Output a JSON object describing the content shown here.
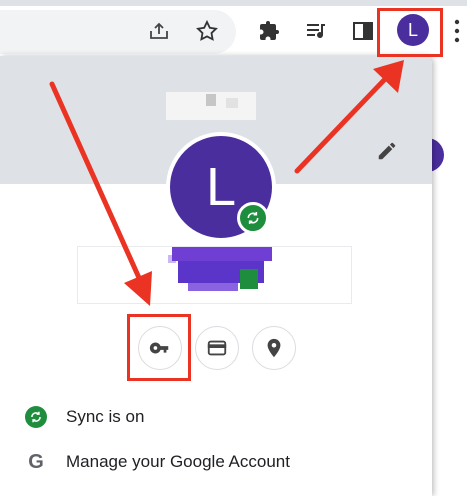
{
  "toolbar": {
    "icons": [
      "share-icon",
      "star-icon",
      "extensions-icon",
      "reading-list-icon",
      "side-panel-icon",
      "more-icon"
    ],
    "avatar_initial": "L"
  },
  "profile": {
    "avatar_initial": "L",
    "edit_icon": "pencil-icon"
  },
  "quick_actions": [
    {
      "name": "passwords",
      "icon": "key-icon"
    },
    {
      "name": "payment-methods",
      "icon": "card-icon"
    },
    {
      "name": "addresses",
      "icon": "location-icon"
    }
  ],
  "menu": {
    "sync_label": "Sync is on",
    "manage_label": "Manage your Google Account",
    "google_letter": "G"
  },
  "colors": {
    "avatar": "#4a2e9d",
    "sync_green": "#1e8e3e",
    "annotation_red": "#ea3323",
    "header_bg": "#dee1e6"
  }
}
